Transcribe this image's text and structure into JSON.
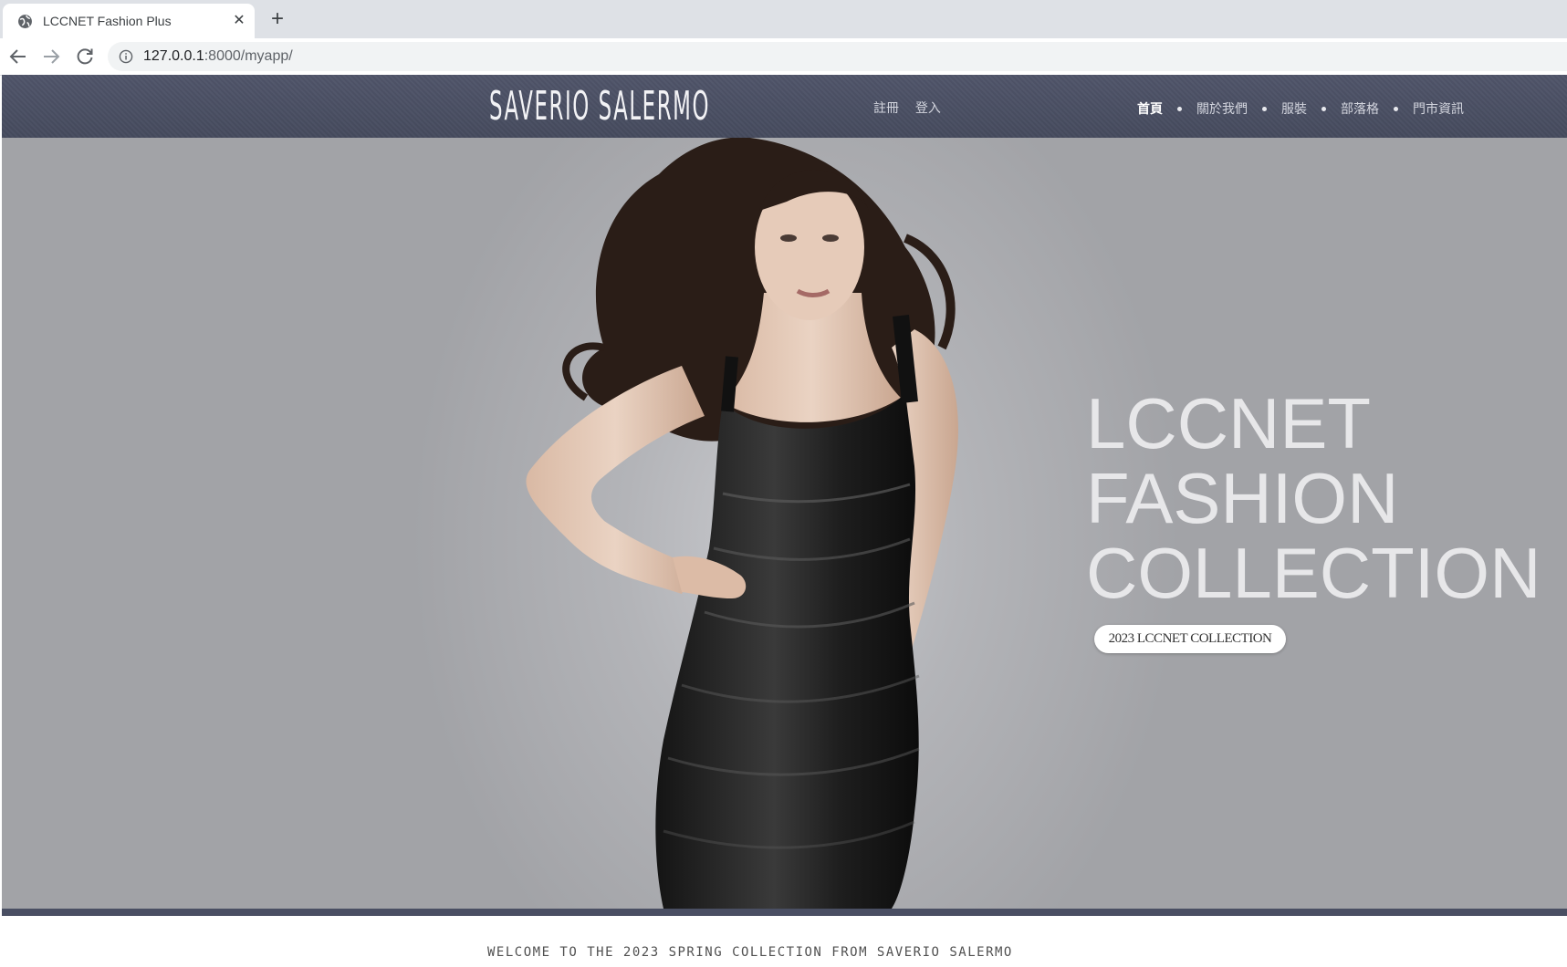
{
  "browser": {
    "tab_title": "LCCNET Fashion Plus",
    "tab_close_glyph": "✕",
    "new_tab_glyph": "+",
    "url_host": "127.0.0.1",
    "url_path": ":8000/myapp/"
  },
  "header": {
    "brand": "SAVERIO SALERMO",
    "auth_links": [
      "註冊",
      "登入"
    ],
    "nav_items": [
      "首頁",
      "關於我們",
      "服裝",
      "部落格",
      "門市資訊"
    ],
    "active_nav": "首頁"
  },
  "hero": {
    "title_lines": [
      "LCCNET",
      "FASHION",
      "COLLECTION"
    ],
    "badge": "2023 LCCNET COLLECTION"
  },
  "welcome": "WELCOME TO THE 2023 SPRING COLLECTION FROM SAVERIO SALERMO",
  "colors": {
    "header_bg": "#4a4f63",
    "hero_bg": "#a2a3a7",
    "hero_text": "#e7e7e9"
  },
  "icons": {
    "favicon": "globe-icon",
    "back": "arrow-left-icon",
    "forward": "arrow-right-icon",
    "reload": "reload-icon",
    "site_info": "info-icon"
  }
}
